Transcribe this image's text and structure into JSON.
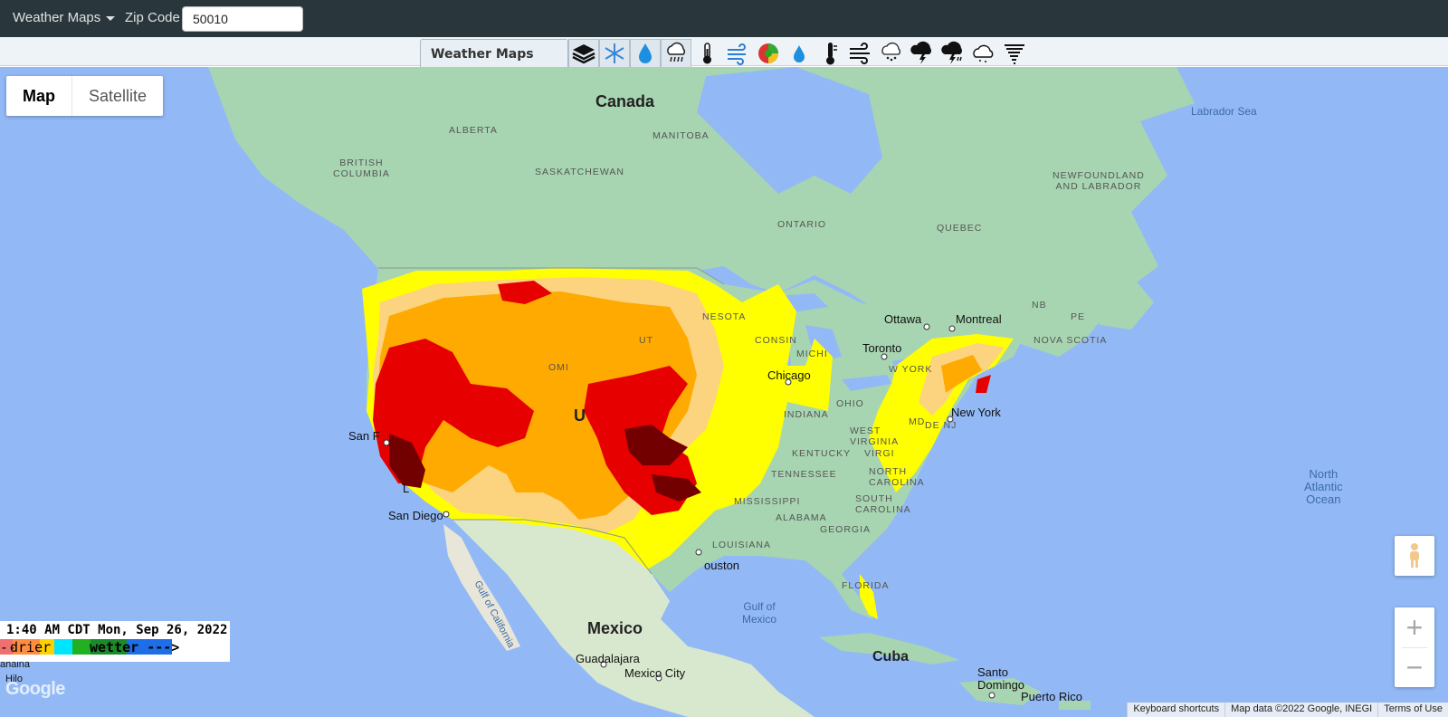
{
  "topbar": {
    "menu_label": "Weather Maps",
    "zip_label": "Zip Code",
    "zip_value": "50010"
  },
  "layer_panel": {
    "title": "Weather Maps"
  },
  "toolbar": {
    "icons": [
      "layers-icon",
      "snowflake-icon",
      "water-drop-icon",
      "rain-cloud-icon",
      "thermometer-icon",
      "wind-icon",
      "radar-icon",
      "humidity-icon",
      "temperature-icon",
      "wind-gust-icon",
      "hail-icon",
      "storm-icon",
      "severe-storm-icon",
      "cloud-icon",
      "tornado-icon"
    ]
  },
  "map_type": {
    "map": "Map",
    "satellite": "Satellite",
    "selected": "Map"
  },
  "labels": {
    "canada": "Canada",
    "mexico": "Mexico",
    "cuba": "Cuba",
    "alberta": "ALBERTA",
    "british_columbia": "BRITISH\nCOLUMBIA",
    "saskatchewan": "SASKATCHEWAN",
    "manitoba": "MANITOBA",
    "ontario": "ONTARIO",
    "quebec": "QUEBEC",
    "newfoundland": "NEWFOUNDLAND\nAND LABRADOR",
    "nova_scotia": "NOVA SCOTIA",
    "pe": "PE",
    "nb": "NB",
    "labrador_sea": "Labrador Sea",
    "north_atlantic": "North\nAtlantic\nOcean",
    "gulf_mexico": "Gulf of\nMexico",
    "gulf_california": "Gulf of California",
    "ottawa": "Ottawa",
    "montreal": "Montreal",
    "toronto": "Toronto",
    "chicago": "Chicago",
    "new_york": "New York",
    "san_francisco": "San F",
    "san_diego": "San Diego",
    "houston": "ouston",
    "guadalajara": "Guadalajara",
    "mexico_city": "Mexico City",
    "santo_domingo": "Santo\nDomingo",
    "puerto_rico": "Puerto Rico",
    "lahaina": "ahaina",
    "hilo": "Hilo",
    "ohio": "OHIO",
    "indiana": "INDIANA",
    "west_virginia": "WEST\nVIRGINIA",
    "virginia": "VIRGI",
    "kentucky": "KENTUCKY",
    "tennessee": "TENNESSEE",
    "north_carolina": "NORTH\nCAROLINA",
    "south_carolina": "SOUTH\nCAROLINA",
    "mississippi": "MISSISSIPPI",
    "alabama": "ALABAMA",
    "georgia": "GEORGIA",
    "louisiana": "LOUISIANA",
    "florida": "FLORIDA",
    "michigan": "MICHI",
    "wisconsin": "CONSIN",
    "minnesota": "NESOTA",
    "new_york_state": "W YORK",
    "md": "MD",
    "dej": "DE NJ",
    "ut": "UT",
    "u": "U",
    "omi": "OMI",
    "l": "L"
  },
  "legend": {
    "timestamp": "1:40 AM CDT Mon, Sep 26, 2022",
    "drier": "drier",
    "wetter": "wetter --->",
    "left_arrow": "--"
  },
  "footer": {
    "google": "Google",
    "keyboard": "Keyboard shortcuts",
    "map_data": "Map data ©2022 Google, INEGI",
    "terms": "Terms of Use"
  },
  "controls": {
    "zoom_in": "+",
    "zoom_out": "−"
  },
  "colors": {
    "ocean": "#92b9f6",
    "land": "#a7d5b1",
    "drought_d0": "#ffff00",
    "drought_d1": "#fcd37f",
    "drought_d2": "#ffaa00",
    "drought_d3": "#e60000",
    "drought_d4": "#730000"
  }
}
